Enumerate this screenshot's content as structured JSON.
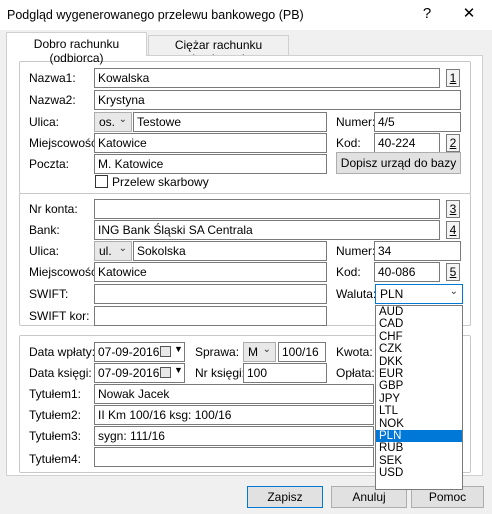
{
  "window": {
    "title": "Podgląd wygenerowanego przelewu bankowego (PB)",
    "help_glyph": "?",
    "close_glyph": "✕"
  },
  "tabs": [
    {
      "label": "Dobro rachunku (odbiorca)",
      "active": true
    },
    {
      "label": "Ciężar rachunku (nadawca)",
      "active": false
    }
  ],
  "recipient": {
    "nazwa1_label": "Nazwa1:",
    "nazwa1_value": "Kowalska",
    "nazwa1_btn": "1",
    "nazwa2_label": "Nazwa2:",
    "nazwa2_value": "Krystyna",
    "ulica_label": "Ulica:",
    "ulica_prefix": "os.",
    "ulica_value": "Testowe",
    "numer_label": "Numer:",
    "numer_value": "4/5",
    "miejscowosc_label": "Miejscowość:",
    "miejscowosc_value": "Katowice",
    "kod_label": "Kod:",
    "kod_value": "40-224",
    "kod_btn": "2",
    "poczta_label": "Poczta:",
    "poczta_value": "M. Katowice",
    "dopisz_button": "Dopisz urząd do bazy",
    "przelew_label": "Przelew skarbowy",
    "przelew_checked": false
  },
  "bank": {
    "konto_label": "Nr konta:",
    "konto_value": "",
    "konto_btn": "3",
    "bank_label": "Bank:",
    "bank_value": "ING Bank Śląski SA Centrala",
    "bank_btn": "4",
    "ulica_label": "Ulica:",
    "ulica_prefix": "ul.",
    "ulica_value": "Sokolska",
    "numer_label": "Numer:",
    "numer_value": "34",
    "miejscowosc_label": "Miejscowość:",
    "miejscowosc_value": "Katowice",
    "kod_label": "Kod:",
    "kod_value": "40-086",
    "kod_btn": "5",
    "swift_label": "SWIFT:",
    "swift_value": "",
    "swift_kor_label": "SWIFT kor:",
    "swift_kor_value": "",
    "waluta_label": "Waluta:",
    "waluta_value": "PLN"
  },
  "currency_options": [
    "AUD",
    "CAD",
    "CHF",
    "CZK",
    "DKK",
    "EUR",
    "GBP",
    "JPY",
    "LTL",
    "NOK",
    "PLN",
    "RUB",
    "SEK",
    "USD"
  ],
  "currency_selected": "PLN",
  "payment": {
    "data_wplaty_label": "Data wpłaty:",
    "data_wplaty_value": "07-09-2016",
    "sprawa_label": "Sprawa:",
    "sprawa_prefix": "M",
    "sprawa_value": "100/16",
    "kwota_label": "Kwota:",
    "data_ksiegi_label": "Data księgi:",
    "data_ksiegi_value": "07-09-2016",
    "nr_ksiegi_label": "Nr księgi:",
    "nr_ksiegi_value": "100",
    "oplata_label": "Opłata:",
    "tytul1_label": "Tytułem1:",
    "tytul1_value": "Nowak Jacek",
    "tytul2_label": "Tytułem2:",
    "tytul2_value": "II Km 100/16 ksg: 100/16",
    "tytul3_label": "Tytułem3:",
    "tytul3_value": "sygn: 111/16",
    "tytul4_label": "Tytułem4:",
    "tytul4_value": ""
  },
  "footer": {
    "zapisz": "Zapisz",
    "anuluj": "Anuluj",
    "pomoc": "Pomoc"
  }
}
